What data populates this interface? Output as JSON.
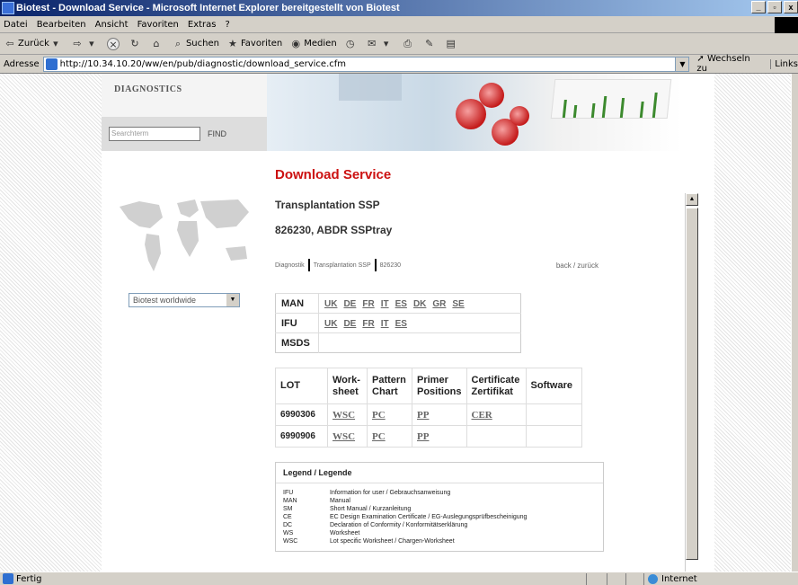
{
  "window": {
    "title": "Biotest - Download Service - Microsoft Internet Explorer bereitgestellt von Biotest"
  },
  "menu": [
    "Datei",
    "Bearbeiten",
    "Ansicht",
    "Favoriten",
    "Extras",
    "?"
  ],
  "toolbar": {
    "back": "Zurück",
    "search": "Suchen",
    "favorites": "Favoriten",
    "media": "Medien"
  },
  "address": {
    "label": "Adresse",
    "url": "http://10.34.10.20/ww/en/pub/diagnostic/download_service.cfm",
    "go": "Wechseln zu",
    "links": "Links"
  },
  "sidebar": {
    "section_title": "DIAGNOSTICS",
    "search_placeholder": "Searchterm",
    "find": "FIND",
    "worldwide": "Biotest worldwide"
  },
  "content": {
    "page_title": "Download Service",
    "product_group": "Transplantation SSP",
    "product": "826230, ABDR SSPtray",
    "breadcrumb": [
      "Diagnostik",
      "Transplantation SSP",
      "826230"
    ],
    "back": "back / zurück"
  },
  "docs": [
    {
      "label": "MAN",
      "langs": [
        "UK",
        "DE",
        "FR",
        "IT",
        "ES",
        "DK",
        "GR",
        "SE"
      ]
    },
    {
      "label": "IFU",
      "langs": [
        "UK",
        "DE",
        "FR",
        "IT",
        "ES"
      ]
    },
    {
      "label": "MSDS",
      "langs": []
    }
  ],
  "lots": {
    "headers": [
      "LOT",
      "Work-\nsheet",
      "Pattern\nChart",
      "Primer\nPositions",
      "Certificate\nZertifikat",
      "Software"
    ],
    "rows": [
      {
        "lot": "6990306",
        "ws": "WSC",
        "pc": "PC",
        "pp": "PP",
        "cer": "CER",
        "sw": ""
      },
      {
        "lot": "6990906",
        "ws": "WSC",
        "pc": "PC",
        "pp": "PP",
        "cer": "",
        "sw": ""
      }
    ]
  },
  "legend": {
    "title": "Legend / Legende",
    "items": [
      {
        "k": "IFU",
        "v": "Information for user / Gebrauchsanweisung"
      },
      {
        "k": "MAN",
        "v": "Manual"
      },
      {
        "k": "SM",
        "v": "Short Manual / Kurzanleitung"
      },
      {
        "k": "CE",
        "v": "EC Design Examination Certificate / EG-Auslegungsprüfbescheinigung"
      },
      {
        "k": "DC",
        "v": "Declaration of Conformity / Konformitätserklärung"
      },
      {
        "k": "WS",
        "v": "Worksheet"
      },
      {
        "k": "WSC",
        "v": "Lot specific Worksheet / Chargen-Worksheet"
      }
    ]
  },
  "status": {
    "text": "Fertig",
    "zone": "Internet"
  }
}
